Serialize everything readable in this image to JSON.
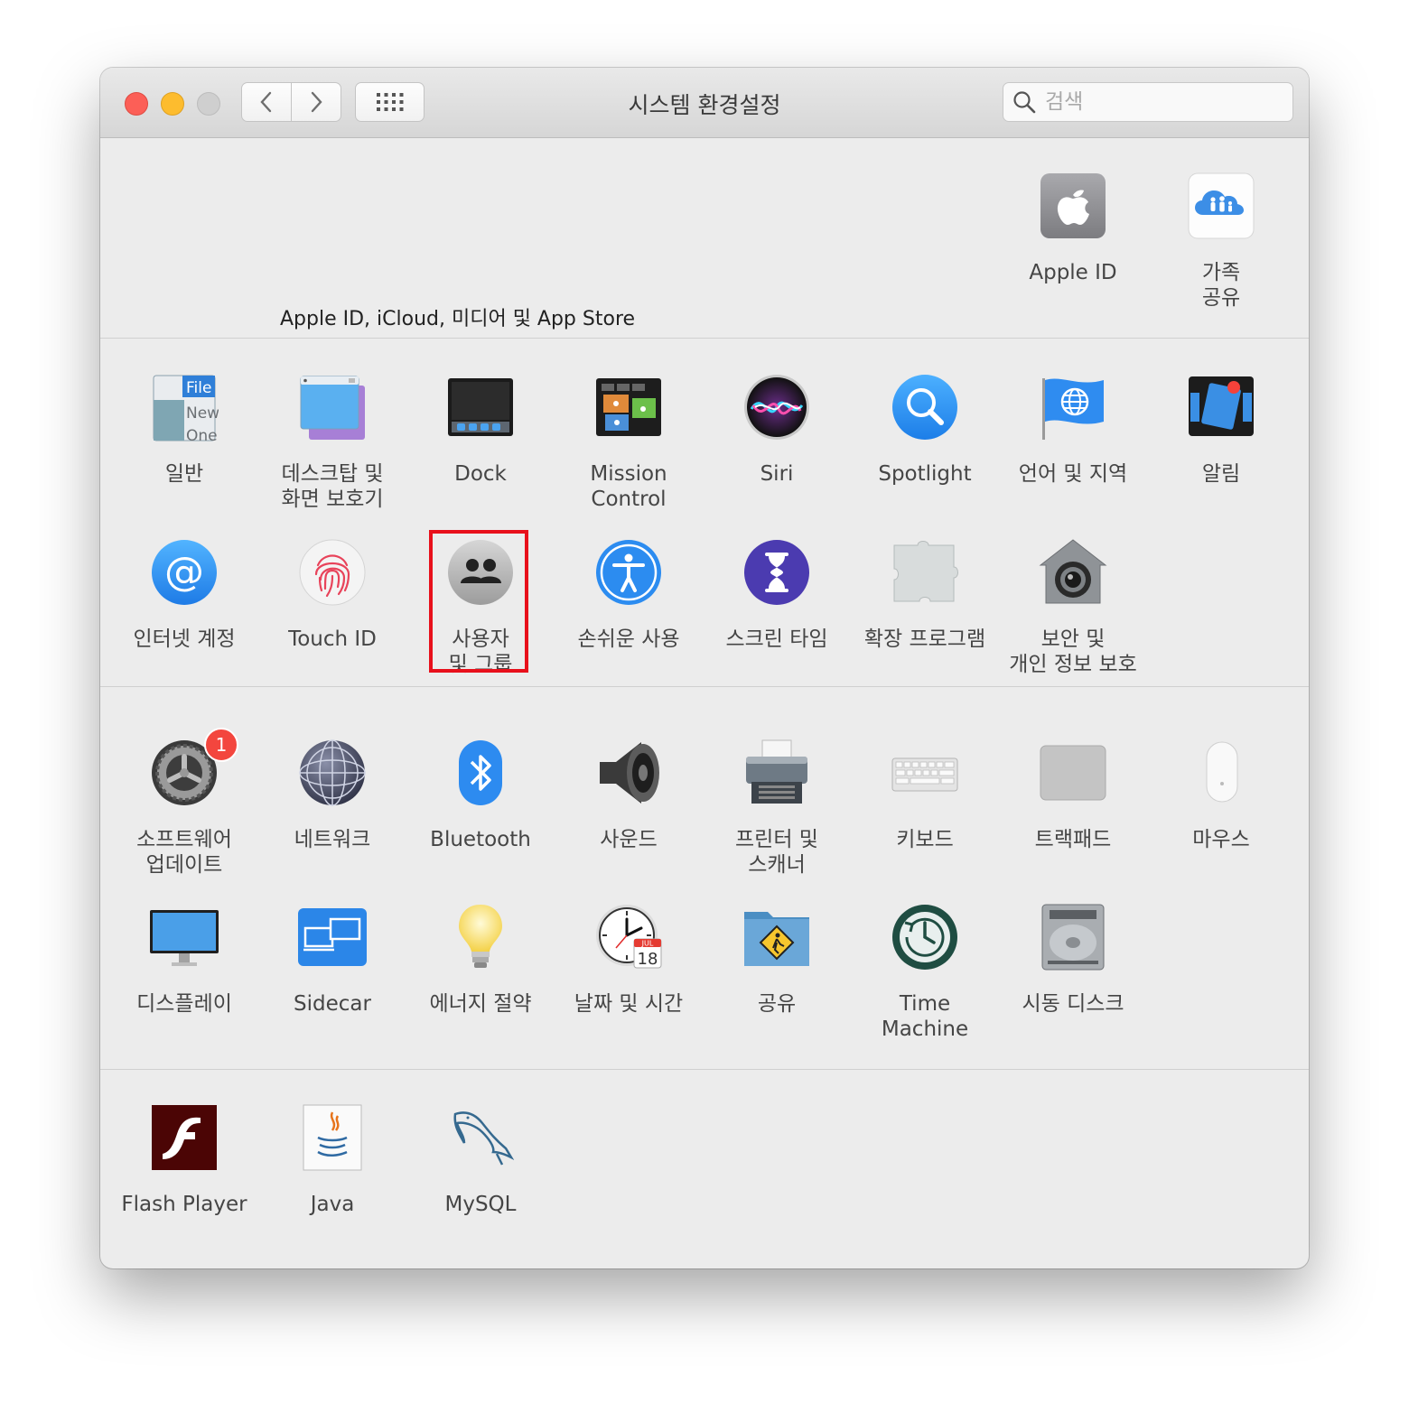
{
  "window": {
    "title": "시스템 환경설정",
    "search_placeholder": "검색"
  },
  "account": {
    "label": "Apple ID, iCloud, 미디어 및 App Store",
    "items": [
      {
        "label": "Apple ID",
        "icon": "apple-id-icon"
      },
      {
        "label": "가족\n공유",
        "icon": "family-sharing-icon"
      }
    ]
  },
  "section1": [
    {
      "label": "일반",
      "icon": "general-icon"
    },
    {
      "label": "데스크탑 및\n화면 보호기",
      "icon": "desktop-screensaver-icon"
    },
    {
      "label": "Dock",
      "icon": "dock-icon"
    },
    {
      "label": "Mission\nControl",
      "icon": "mission-control-icon"
    },
    {
      "label": "Siri",
      "icon": "siri-icon"
    },
    {
      "label": "Spotlight",
      "icon": "spotlight-icon"
    },
    {
      "label": "언어 및 지역",
      "icon": "language-region-icon"
    },
    {
      "label": "알림",
      "icon": "notifications-icon"
    },
    {
      "label": "인터넷 계정",
      "icon": "internet-accounts-icon"
    },
    {
      "label": "Touch ID",
      "icon": "touch-id-icon"
    },
    {
      "label": "사용자\n및 그룹",
      "icon": "users-groups-icon"
    },
    {
      "label": "손쉬운 사용",
      "icon": "accessibility-icon"
    },
    {
      "label": "스크린 타임",
      "icon": "screen-time-icon"
    },
    {
      "label": "확장 프로그램",
      "icon": "extensions-icon"
    },
    {
      "label": "보안 및\n개인 정보 보호",
      "icon": "security-privacy-icon"
    }
  ],
  "section2": [
    {
      "label": "소프트웨어\n업데이트",
      "icon": "software-update-icon",
      "badge": "1"
    },
    {
      "label": "네트워크",
      "icon": "network-icon"
    },
    {
      "label": "Bluetooth",
      "icon": "bluetooth-icon"
    },
    {
      "label": "사운드",
      "icon": "sound-icon"
    },
    {
      "label": "프린터 및\n스캐너",
      "icon": "printers-scanners-icon"
    },
    {
      "label": "키보드",
      "icon": "keyboard-icon"
    },
    {
      "label": "트랙패드",
      "icon": "trackpad-icon"
    },
    {
      "label": "마우스",
      "icon": "mouse-icon"
    },
    {
      "label": "디스플레이",
      "icon": "displays-icon"
    },
    {
      "label": "Sidecar",
      "icon": "sidecar-icon"
    },
    {
      "label": "에너지 절약",
      "icon": "energy-saver-icon"
    },
    {
      "label": "날짜 및 시간",
      "icon": "date-time-icon"
    },
    {
      "label": "공유",
      "icon": "sharing-icon"
    },
    {
      "label": "Time\nMachine",
      "icon": "time-machine-icon"
    },
    {
      "label": "시동 디스크",
      "icon": "startup-disk-icon"
    }
  ],
  "section3": [
    {
      "label": "Flash Player",
      "icon": "flash-player-icon"
    },
    {
      "label": "Java",
      "icon": "java-icon"
    },
    {
      "label": "MySQL",
      "icon": "mysql-icon"
    }
  ],
  "calendar_icon": {
    "month": "JUL",
    "day": "18"
  },
  "general_icon_text": {
    "line1": "File",
    "line2": "New",
    "line3": "One"
  }
}
